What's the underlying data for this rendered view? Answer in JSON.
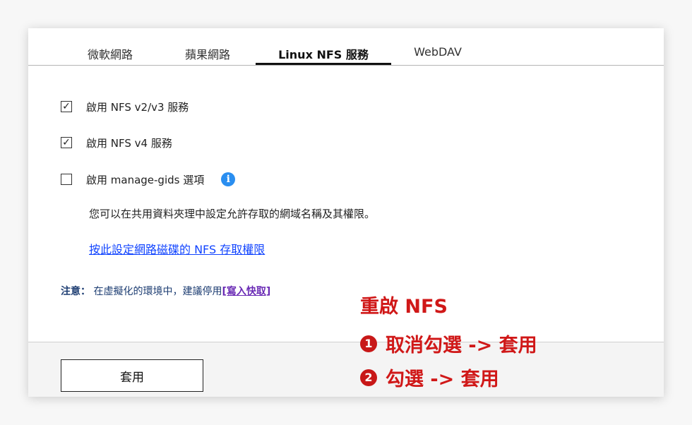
{
  "tabs": [
    {
      "label": "微軟網路"
    },
    {
      "label": "蘋果網路"
    },
    {
      "label": "Linux NFS 服務",
      "active": true
    },
    {
      "label": "WebDAV"
    }
  ],
  "options": [
    {
      "label": "啟用 NFS v2/v3 服務",
      "checked": true,
      "check_glyph": "✓"
    },
    {
      "label": "啟用 NFS v4 服務",
      "checked": true,
      "check_glyph": "✓"
    },
    {
      "label": "啟用 manage-gids 選項",
      "checked": false,
      "check_glyph": ""
    }
  ],
  "info_glyph": "i",
  "description": "您可以在共用資料夾理中設定允許存取的網域名稱及其權限。",
  "nfs_link": "按此設定網路磁碟的 NFS 存取權限",
  "note": {
    "label": "注意：",
    "text": "在虛擬化的環境中，建議停用",
    "link": "[寫入快取]"
  },
  "apply_button": "套用",
  "annotation": {
    "title": "重啟 NFS",
    "steps": [
      {
        "num": "1",
        "text": "取消勾選 -> 套用"
      },
      {
        "num": "2",
        "text": "勾選 -> 套用"
      }
    ],
    "color": "#d01818"
  },
  "colors": {
    "link": "#1144ff",
    "info": "#2a8ef0",
    "note": "#1d3d72"
  }
}
